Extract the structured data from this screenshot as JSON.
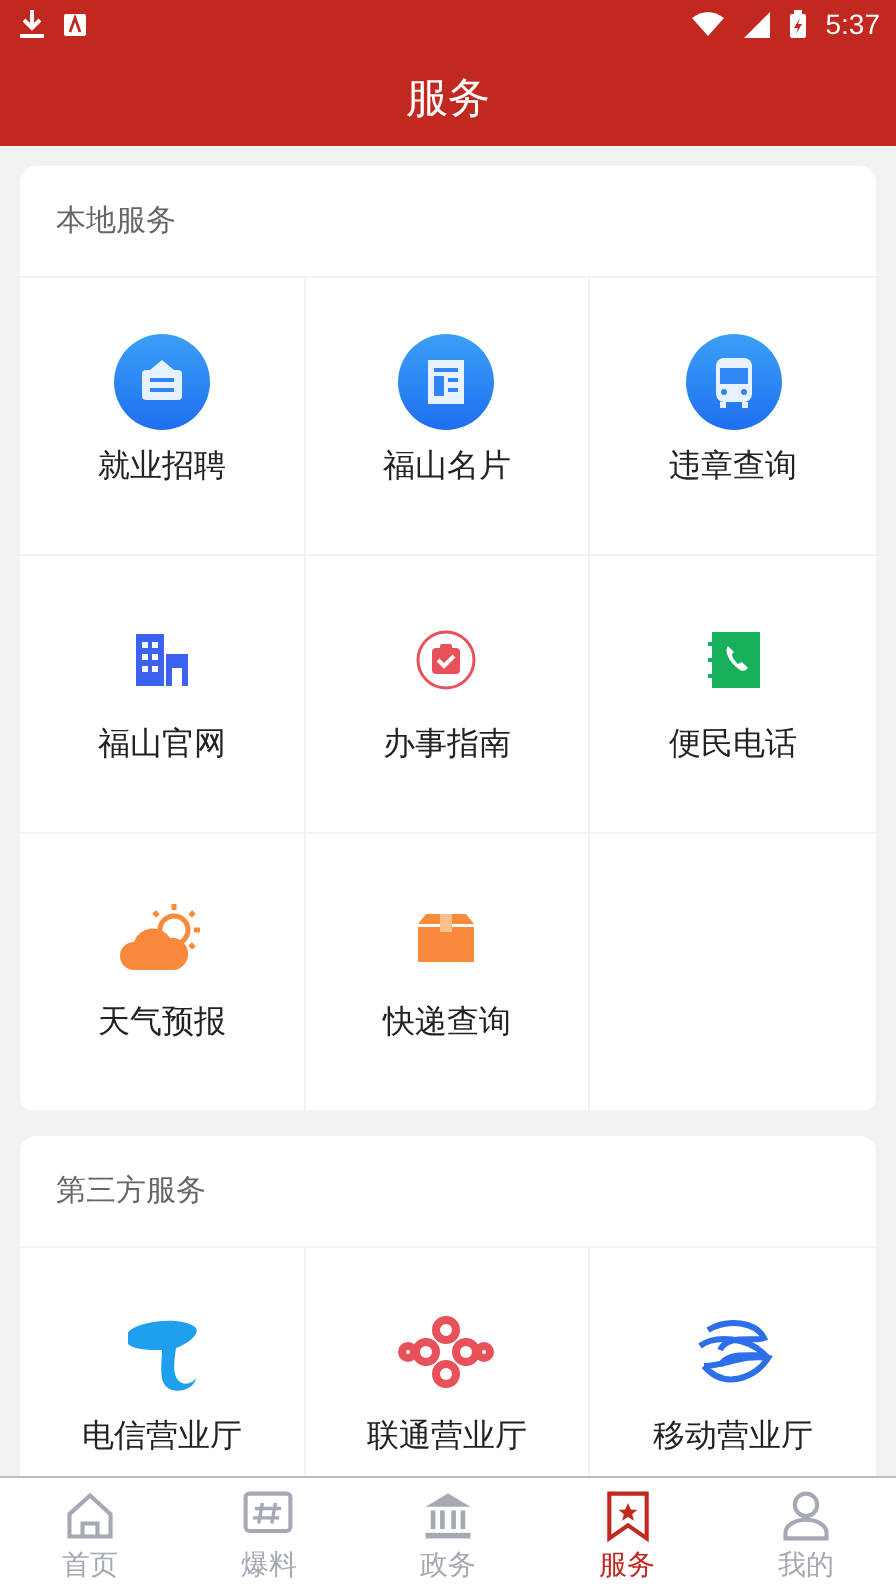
{
  "status_bar": {
    "time": "5:37"
  },
  "header": {
    "title": "服务"
  },
  "sections": [
    {
      "title": "本地服务",
      "items": [
        {
          "label": "就业招聘"
        },
        {
          "label": "福山名片"
        },
        {
          "label": "违章查询"
        },
        {
          "label": "福山官网"
        },
        {
          "label": "办事指南"
        },
        {
          "label": "便民电话"
        },
        {
          "label": "天气预报"
        },
        {
          "label": "快递查询"
        }
      ]
    },
    {
      "title": "第三方服务",
      "items": [
        {
          "label": "电信营业厅"
        },
        {
          "label": "联通营业厅"
        },
        {
          "label": "移动营业厅"
        }
      ]
    }
  ],
  "tab_bar": [
    {
      "label": "首页",
      "selected": false
    },
    {
      "label": "爆料",
      "selected": false
    },
    {
      "label": "政务",
      "selected": false
    },
    {
      "label": "服务",
      "selected": true
    },
    {
      "label": "我的",
      "selected": false
    }
  ]
}
